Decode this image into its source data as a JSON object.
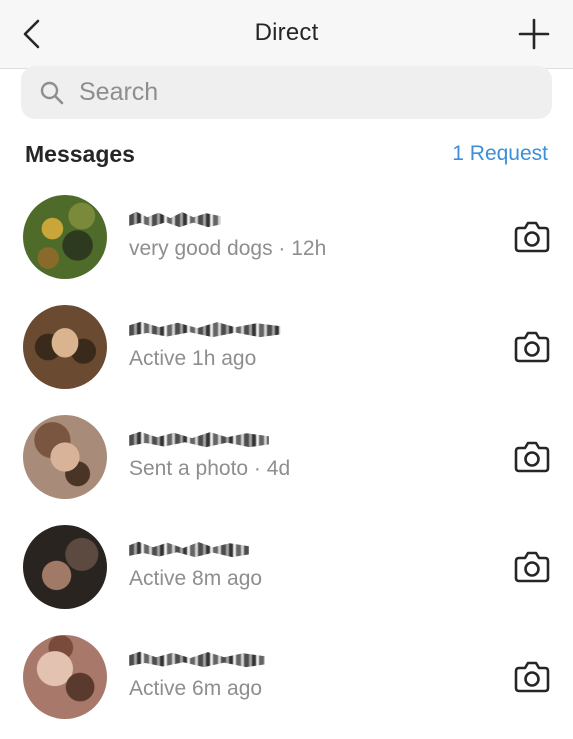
{
  "header": {
    "title": "Direct",
    "back_icon": "chevron-left-icon",
    "new_icon": "plus-icon"
  },
  "search": {
    "placeholder": "Search",
    "value": ""
  },
  "messages_section": {
    "title": "Messages",
    "request_label": "1 Request",
    "request_color": "#3d8fd9"
  },
  "threads": [
    {
      "subtitle": "very good dogs · 12h",
      "avatar_colors": [
        "#4f6b2a",
        "#c9a53a",
        "#2d3a1f"
      ]
    },
    {
      "subtitle": "Active 1h ago",
      "avatar_colors": [
        "#6b4a32",
        "#d9b48f",
        "#3a2a1c"
      ]
    },
    {
      "subtitle": "Sent a photo · 4d",
      "avatar_colors": [
        "#7a5640",
        "#d8b39a",
        "#4a3426"
      ]
    },
    {
      "subtitle": "Active 8m ago",
      "avatar_colors": [
        "#2a2420",
        "#a07a66",
        "#5c4a40"
      ]
    },
    {
      "subtitle": "Active 6m ago",
      "avatar_colors": [
        "#a8796a",
        "#e3c2b1",
        "#5a3a2c"
      ]
    }
  ]
}
